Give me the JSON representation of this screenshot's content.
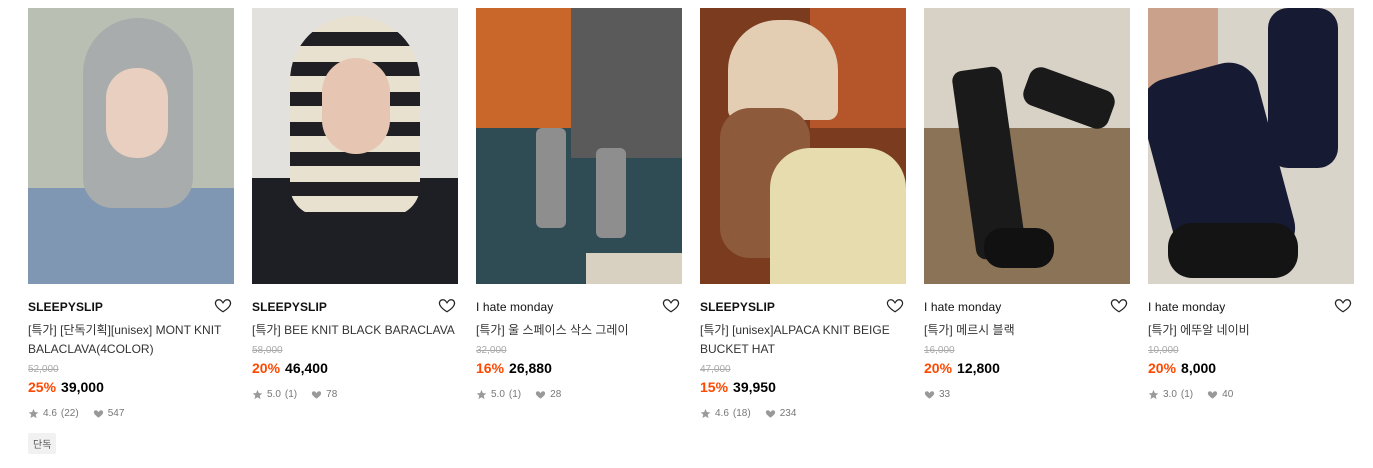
{
  "colors": {
    "discount": "#ff4800",
    "price": "#000000",
    "original_price": "#aaaaaa",
    "meta": "#777777"
  },
  "products": [
    {
      "brand": "SLEEPYSLIP",
      "title": "[특가] [단독기획][unisex] MONT KNIT BALACLAVA(4COLOR)",
      "original_price": "52,000",
      "discount": "25%",
      "price": "39,000",
      "rating": "4.6",
      "reviews": "(22)",
      "likes": "547",
      "tag": "단독",
      "icons": [
        "heart-icon",
        "star-icon",
        "heart-small-icon"
      ]
    },
    {
      "brand": "SLEEPYSLIP",
      "title": "[특가] BEE KNIT BLACK BARACLAVA",
      "original_price": "58,000",
      "discount": "20%",
      "price": "46,400",
      "rating": "5.0",
      "reviews": "(1)",
      "likes": "78",
      "icons": [
        "heart-icon",
        "star-icon",
        "heart-small-icon"
      ]
    },
    {
      "brand": "I hate monday",
      "title": "[특가] 울 스페이스 삭스 그레이",
      "original_price": "32,000",
      "discount": "16%",
      "price": "26,880",
      "rating": "5.0",
      "reviews": "(1)",
      "likes": "28",
      "icons": [
        "heart-icon",
        "star-icon",
        "heart-small-icon"
      ]
    },
    {
      "brand": "SLEEPYSLIP",
      "title": "[특가] [unisex]ALPACA KNIT BEIGE BUCKET HAT",
      "original_price": "47,000",
      "discount": "15%",
      "price": "39,950",
      "rating": "4.6",
      "reviews": "(18)",
      "likes": "234",
      "icons": [
        "heart-icon",
        "star-icon",
        "heart-small-icon"
      ]
    },
    {
      "brand": "I hate monday",
      "title": "[특가] 메르시 블랙",
      "original_price": "16,000",
      "discount": "20%",
      "price": "12,800",
      "likes": "33",
      "icons": [
        "heart-icon",
        "heart-small-icon"
      ]
    },
    {
      "brand": "I hate monday",
      "title": "[특가] 에뚜알 네이비",
      "original_price": "10,000",
      "discount": "20%",
      "price": "8,000",
      "rating": "3.0",
      "reviews": "(1)",
      "likes": "40",
      "icons": [
        "heart-icon",
        "star-icon",
        "heart-small-icon"
      ]
    }
  ]
}
